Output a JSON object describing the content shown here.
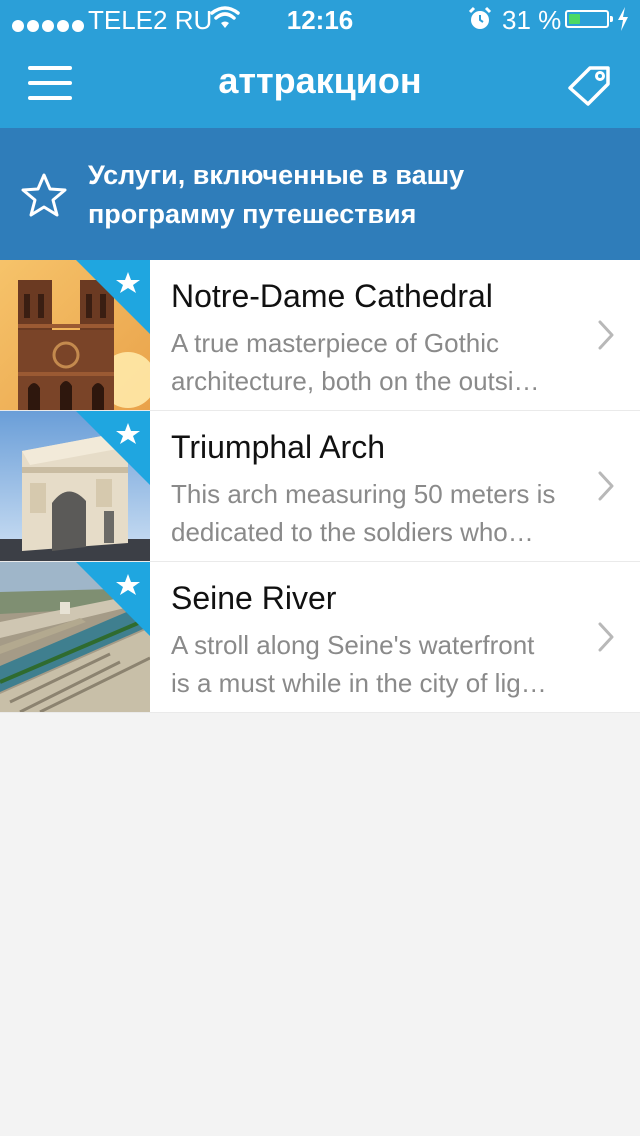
{
  "status_bar": {
    "carrier": "TELE2 RU",
    "time": "12:16",
    "battery_text": "31 %",
    "battery_level": 0.31
  },
  "nav": {
    "title": "аттракцион",
    "menu_icon": "hamburger-menu-icon",
    "tag_icon": "tag-icon"
  },
  "banner": {
    "line1": "Услуги, включенные в вашу",
    "line2": "программу путешествия",
    "icon": "star-outline-icon"
  },
  "items": [
    {
      "title": "Notre-Dame Cathedral",
      "desc_line1": "A true masterpiece of Gothic",
      "desc_line2": "architecture, both on the outsi…",
      "image": "notre-dame-photo"
    },
    {
      "title": "Triumphal Arch",
      "desc_line1": "This arch measuring 50 meters is",
      "desc_line2": "dedicated to the soldiers who…",
      "image": "triumphal-arch-photo"
    },
    {
      "title": "Seine River",
      "desc_line1": "A stroll along Seine's waterfront",
      "desc_line2": "is a must while in the city of lig…",
      "image": "seine-river-photo"
    }
  ],
  "colors": {
    "nav_blue": "#2b9fd8",
    "banner_blue": "#2f7dba",
    "corner_badge": "#1fa6e0",
    "battery_green": "#4cd964"
  }
}
